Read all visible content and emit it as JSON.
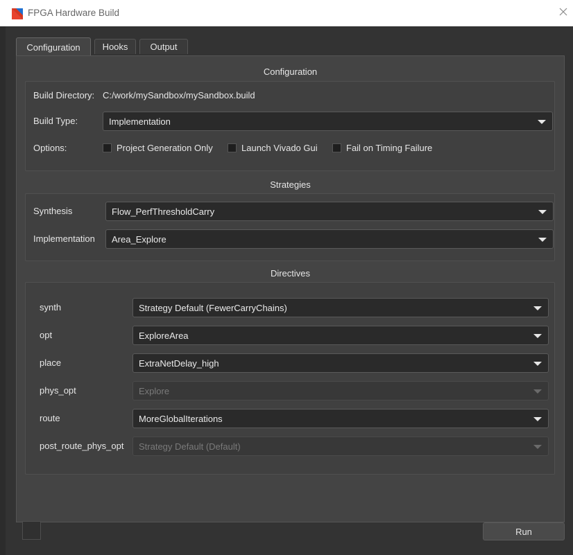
{
  "window": {
    "title": "FPGA Hardware Build",
    "icon": "app-logo-icon",
    "close_icon": "close-icon"
  },
  "tabs": [
    {
      "label": "Configuration",
      "active": true
    },
    {
      "label": "Hooks",
      "active": false
    },
    {
      "label": "Output",
      "active": false
    }
  ],
  "configuration": {
    "title": "Configuration",
    "build_directory_label": "Build Directory:",
    "build_directory_value": "C:/work/mySandbox/mySandbox.build",
    "build_type_label": "Build Type:",
    "build_type_value": "Implementation",
    "options_label": "Options:",
    "options": [
      {
        "label": "Project Generation Only",
        "checked": false
      },
      {
        "label": "Launch Vivado Gui",
        "checked": false
      },
      {
        "label": "Fail on Timing Failure",
        "checked": false
      }
    ]
  },
  "strategies": {
    "title": "Strategies",
    "synthesis_label": "Synthesis",
    "synthesis_value": "Flow_PerfThresholdCarry",
    "implementation_label": "Implementation",
    "implementation_value": "Area_Explore"
  },
  "directives": {
    "title": "Directives",
    "rows": [
      {
        "label": "synth",
        "value": "Strategy Default (FewerCarryChains)",
        "enabled": true
      },
      {
        "label": "opt",
        "value": "ExploreArea",
        "enabled": true
      },
      {
        "label": "place",
        "value": "ExtraNetDelay_high",
        "enabled": true
      },
      {
        "label": "phys_opt",
        "value": "Explore",
        "enabled": false
      },
      {
        "label": "route",
        "value": "MoreGlobalIterations",
        "enabled": true
      },
      {
        "label": "post_route_phys_opt",
        "value": "Strategy Default (Default)",
        "enabled": false
      }
    ]
  },
  "footer": {
    "run_label": "Run"
  },
  "colors": {
    "background": "#2c2c2c",
    "panel": "#444444",
    "text": "#e6e6e6",
    "disabled_text": "#7a7a7a"
  }
}
